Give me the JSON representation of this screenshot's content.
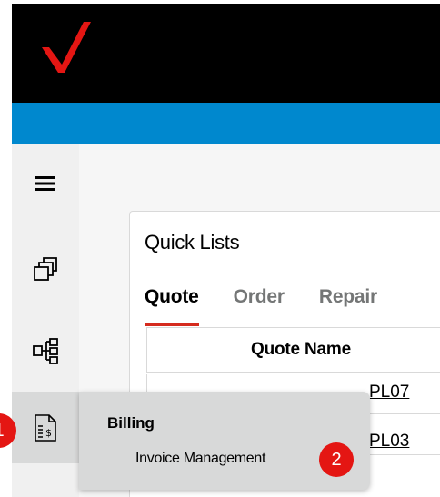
{
  "quick_lists": {
    "title": "Quick Lists",
    "tabs": [
      "Quote",
      "Order",
      "Repair"
    ],
    "active_tab": "Quote",
    "column_header": "Quote Name",
    "rows": [
      "PL07",
      "PL03"
    ]
  },
  "billing_menu": {
    "title": "Billing",
    "item": "Invoice Management"
  },
  "annotations": {
    "step1": "1",
    "step2": "2"
  },
  "colors": {
    "brand_red": "#d52b1e",
    "top_bar": "#000000",
    "accent_blue": "#0088ce",
    "badge_red": "#e41613"
  },
  "icons": {
    "logo": "verizon-checkmark-logo",
    "menu": "hamburger-menu-icon",
    "windows": "stacked-windows-icon",
    "hierarchy": "hierarchy-tree-icon",
    "billing": "billing-document-icon"
  }
}
